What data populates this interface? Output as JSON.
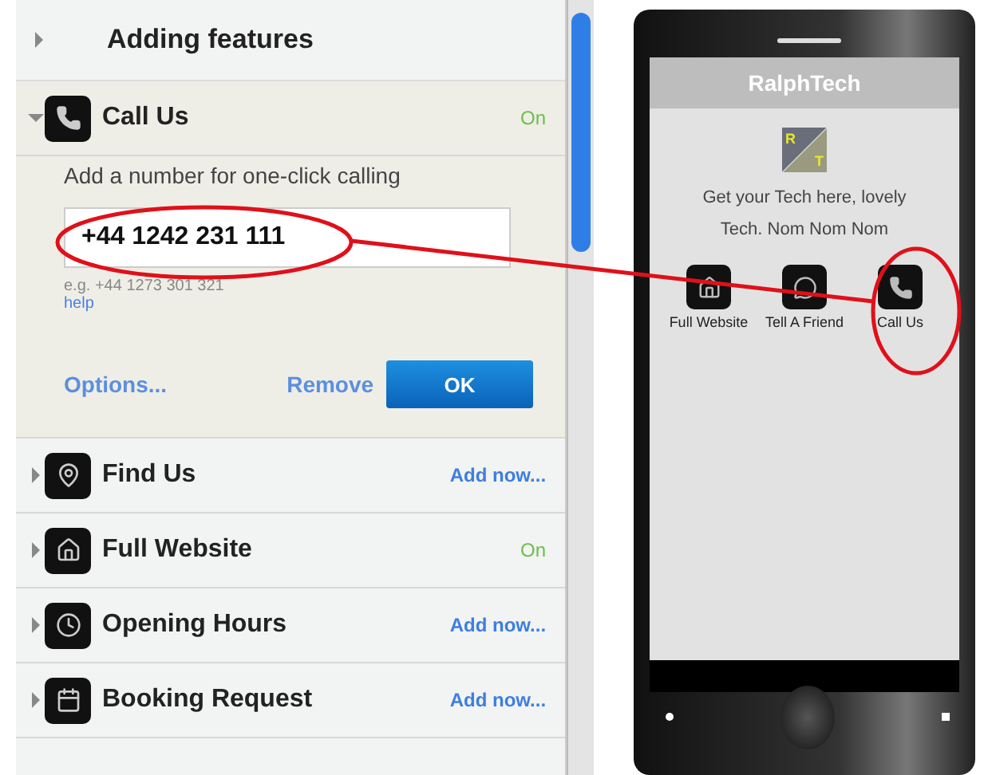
{
  "features_panel": {
    "header": {
      "label": "Adding features",
      "expanded": false
    },
    "items": [
      {
        "label": "Call Us",
        "expanded": true,
        "status": {
          "kind": "on",
          "text": "On"
        },
        "detail": {
          "prompt": "Add a number for one-click calling",
          "value": "+44 1242 231 111",
          "example": "e.g. +44 1273 301 321",
          "help": "help",
          "options": "Options...",
          "remove": "Remove",
          "ok": "OK"
        }
      },
      {
        "label": "Find Us",
        "expanded": false,
        "status": {
          "kind": "add",
          "text": "Add now..."
        }
      },
      {
        "label": "Full Website",
        "expanded": false,
        "status": {
          "kind": "on",
          "text": "On"
        }
      },
      {
        "label": "Opening Hours",
        "expanded": false,
        "status": {
          "kind": "add",
          "text": "Add now..."
        }
      },
      {
        "label": "Booking Request",
        "expanded": false,
        "status": {
          "kind": "add",
          "text": "Add now..."
        }
      }
    ]
  },
  "phone_preview": {
    "title": "RalphTech",
    "logo": [
      "R",
      "T"
    ],
    "tagline": "Get your Tech here, lovely Tech. Nom Nom Nom",
    "shortcuts": [
      {
        "label": "Full Website"
      },
      {
        "label": "Tell A Friend"
      },
      {
        "label": "Call Us"
      }
    ]
  }
}
